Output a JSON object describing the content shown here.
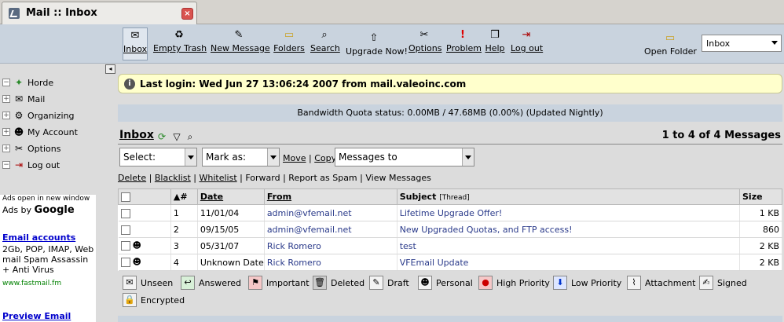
{
  "browser": {
    "tab_title": "Mail :: Inbox",
    "close_icon": "close-icon"
  },
  "toolbar": {
    "items": [
      {
        "label": "Inbox",
        "icon": "inbox-icon"
      },
      {
        "label": "Empty Trash",
        "icon": "trash-icon"
      },
      {
        "label": "New Message",
        "icon": "compose-icon"
      },
      {
        "label": "Folders",
        "icon": "folder-icon"
      },
      {
        "label": "Search",
        "icon": "search-icon"
      },
      {
        "label": "Upgrade Now!",
        "icon": "upgrade-icon"
      },
      {
        "label": "Options",
        "icon": "options-icon"
      },
      {
        "label": "Problem",
        "icon": "problem-icon"
      },
      {
        "label": "Help",
        "icon": "help-icon"
      },
      {
        "label": "Log out",
        "icon": "logout-icon"
      }
    ],
    "open_folder_label": "Open Folder",
    "open_folder_value": "Inbox"
  },
  "sidebar": {
    "items": [
      {
        "label": "Horde",
        "tree": "−",
        "icon": "horde-icon"
      },
      {
        "label": "Mail",
        "tree": "+",
        "icon": "mail-icon"
      },
      {
        "label": "Organizing",
        "tree": "+",
        "icon": "organizing-icon"
      },
      {
        "label": "My Account",
        "tree": "+",
        "icon": "account-icon"
      },
      {
        "label": "Options",
        "tree": "+",
        "icon": "options-icon"
      },
      {
        "label": "Log out",
        "tree": "−",
        "icon": "logout-icon"
      }
    ],
    "ads_note": "Ads open in new window",
    "ads_by": "Ads by",
    "ads_brand": "Google",
    "ad1_title": "Email accounts",
    "ad1_text": "2Gb, POP, IMAP, Web mail Spam Assassin + Anti Virus",
    "ad1_url": "www.fastmail.fm",
    "ad2_title": "Preview Email Before"
  },
  "notice": {
    "last_login": "Last login: Wed Jun 27 13:06:24 2007 from mail.valeoinc.com"
  },
  "quota": {
    "text": "Bandwidth Quota status: 0.00MB / 47.68MB (0.00%) (Updated Nightly)"
  },
  "mailbox": {
    "title": "Inbox",
    "count": "1 to 4 of 4 Messages"
  },
  "actions": {
    "select_label": "Select:",
    "mark_label": "Mark as:",
    "move": "Move",
    "copy": "Copy",
    "target_label": "Messages to",
    "links": [
      "Delete",
      "Blacklist",
      "Whitelist",
      "Forward",
      "Report as Spam",
      "View Messages"
    ]
  },
  "table": {
    "headers": {
      "num": "▲#",
      "date": "Date",
      "from": "From",
      "subject": "Subject",
      "thread": "[Thread]",
      "size": "Size"
    },
    "rows": [
      {
        "num": "1",
        "date": "11/01/04",
        "from": "admin@vfemail.net",
        "subject": "Lifetime Upgrade Offer!",
        "size": "1 KB"
      },
      {
        "num": "2",
        "date": "09/15/05",
        "from": "admin@vfemail.net",
        "subject": "New Upgraded Quotas, and FTP access!",
        "size": "860"
      },
      {
        "num": "3",
        "date": "05/31/07",
        "from": "Rick Romero",
        "subject": "test",
        "size": "2 KB"
      },
      {
        "num": "4",
        "date": "Unknown Date",
        "from": "Rick Romero",
        "subject": "VFEmail Update",
        "size": "2 KB"
      }
    ]
  },
  "legend": {
    "items": [
      {
        "label": "Unseen",
        "icon": "unseen-icon"
      },
      {
        "label": "Answered",
        "icon": "answered-icon"
      },
      {
        "label": "Important",
        "icon": "important-icon"
      },
      {
        "label": "Deleted",
        "icon": "deleted-icon"
      },
      {
        "label": "Draft",
        "icon": "draft-icon"
      },
      {
        "label": "Personal",
        "icon": "personal-icon"
      },
      {
        "label": "High Priority",
        "icon": "high-priority-icon"
      },
      {
        "label": "Low Priority",
        "icon": "low-priority-icon"
      },
      {
        "label": "Attachment",
        "icon": "attachment-icon"
      },
      {
        "label": "Signed",
        "icon": "signed-icon"
      },
      {
        "label": "Encrypted",
        "icon": "encrypted-icon"
      }
    ]
  }
}
